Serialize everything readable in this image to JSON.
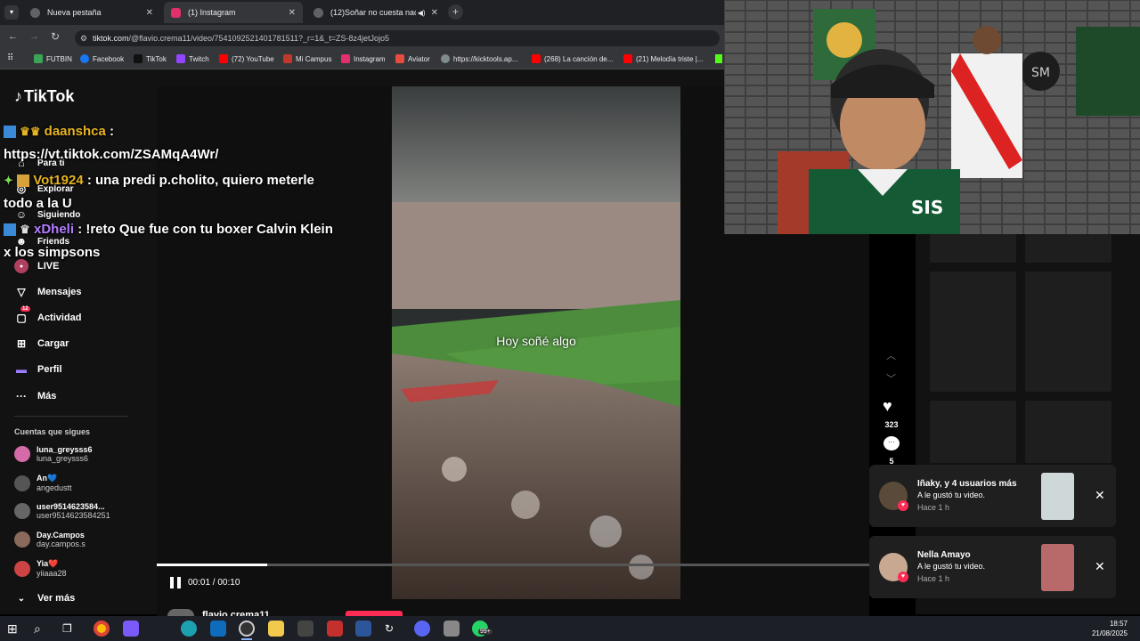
{
  "browser": {
    "tabs": [
      {
        "title": "Nueva pestaña",
        "color": "#5f6368",
        "active": false
      },
      {
        "title": "(1) Instagram",
        "color": "#e1306c",
        "active": true
      },
      {
        "title": "(12)Soñar no cuesta nada 🫡",
        "color": "#5f6368",
        "active": false
      }
    ],
    "url_host": "tiktok.com",
    "url_path": "/@flavio.crema11/video/7541092521401781511?_r=1&_t=ZS-8z4jetJojo5",
    "bookmarks": [
      {
        "label": "FUTBIN",
        "color": "#3aa655"
      },
      {
        "label": "Facebook",
        "color": "#1877f2"
      },
      {
        "label": "TikTok",
        "color": "#111111"
      },
      {
        "label": "Twitch",
        "color": "#9146ff"
      },
      {
        "label": "(72) YouTube",
        "color": "#ff0000"
      },
      {
        "label": "Mi Campus",
        "color": "#c0392b"
      },
      {
        "label": "Instagram",
        "color": "#e1306c"
      },
      {
        "label": "Aviator",
        "color": "#e74c3c"
      },
      {
        "label": "https://kicktools.ap...",
        "color": "#7f8c8d"
      },
      {
        "label": "(268) La canción de...",
        "color": "#ff0000"
      },
      {
        "label": "(21) Melodía triste |...",
        "color": "#ff0000"
      }
    ]
  },
  "tiktok": {
    "logo": "TikTok",
    "nav": [
      {
        "label": "Para ti",
        "icon": "home-icon"
      },
      {
        "label": "Explorar",
        "icon": "compass-icon"
      },
      {
        "label": "Siguiendo",
        "icon": "following-icon"
      },
      {
        "label": "Friends",
        "icon": "friends-icon"
      },
      {
        "label": "LIVE",
        "icon": "live-icon"
      },
      {
        "label": "Mensajes",
        "icon": "send-icon"
      },
      {
        "label": "Actividad",
        "icon": "activity-icon",
        "badge": "12"
      },
      {
        "label": "Cargar",
        "icon": "upload-icon"
      },
      {
        "label": "Perfil",
        "icon": "profile-icon"
      },
      {
        "label": "Más",
        "icon": "more-icon"
      }
    ],
    "following_title": "Cuentas que sigues",
    "following": [
      {
        "name": "luna_greysss6",
        "handle": "luna_greysss6",
        "color": "#d46aa8"
      },
      {
        "name": "An💙",
        "handle": "angedustt",
        "color": "#555"
      },
      {
        "name": "user9514623584...",
        "handle": "user9514623584251",
        "color": "#666"
      },
      {
        "name": "Day.Campos",
        "handle": "day.campos.s",
        "color": "#8a6a5a"
      },
      {
        "name": "Yia❤️",
        "handle": "yiiaaa28",
        "color": "#c44"
      }
    ],
    "see_more": "Ver más",
    "video": {
      "caption": "Hoy soñé algo",
      "time": "00:01 / 00:10",
      "progress": 0.1,
      "likes": "323",
      "comments": "5",
      "author": "flavio.crema11"
    }
  },
  "chat": [
    {
      "user": "daanshca",
      "user_color": "#e6b422",
      "msg": ":",
      "line2": "https://vt.tiktok.com/ZSAMqA4Wr/"
    },
    {
      "user": "Vot1924",
      "user_color": "#e6b422",
      "msg": ": una predi p.cholito, quiero meterle",
      "line2": "todo a la U"
    },
    {
      "user": "xDheli",
      "user_color": "#b47cff",
      "msg": ": !reto Que fue con tu boxer Calvin Klein",
      "line2": "x los simpsons"
    }
  ],
  "notifications": [
    {
      "line1": "Iñaky,  y 4 usuarios más",
      "line2": "A le gustó tu video.",
      "line3": "Hace 1 h"
    },
    {
      "line1": "Nella Amayo",
      "line2": "A le gustó tu video.",
      "line3": "Hace 1 h"
    }
  ],
  "taskbar": {
    "time": "18:57",
    "date": "21/08/2025",
    "whatsapp_badge": "99+"
  }
}
